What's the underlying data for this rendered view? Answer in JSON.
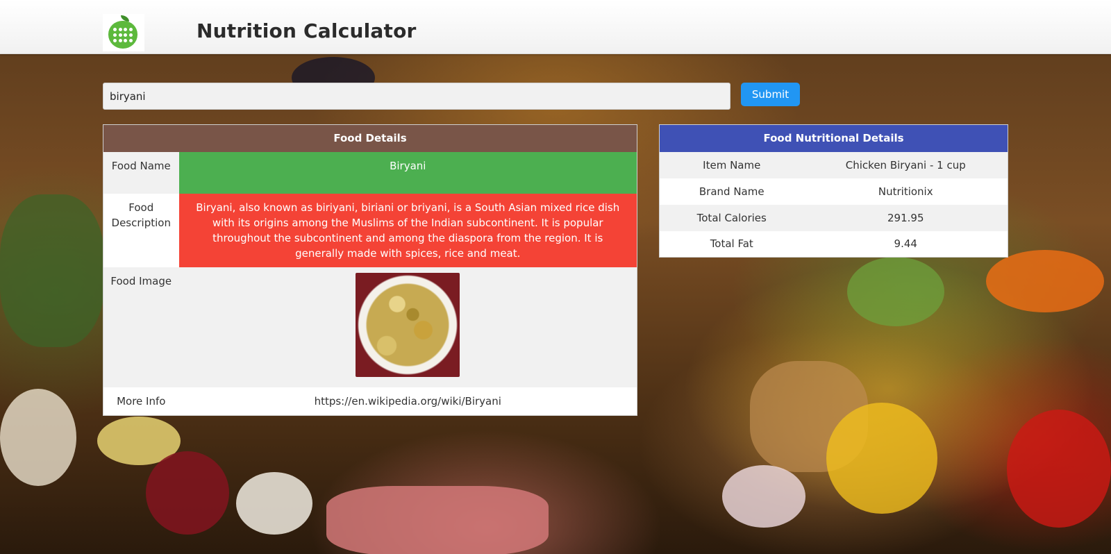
{
  "header": {
    "title": "Nutrition Calculator"
  },
  "search": {
    "value": "biryani",
    "submit_label": "Submit"
  },
  "food_details": {
    "heading": "Food Details",
    "rows": {
      "name": {
        "label": "Food Name",
        "value": "Biryani"
      },
      "description": {
        "label": "Food Description",
        "value": "Biryani, also known as biriyani, biriani or briyani, is a South Asian mixed rice dish with its origins among the Muslims of the Indian subcontinent. It is popular throughout the subcontinent and among the diaspora from the region. It is generally made with spices, rice and meat."
      },
      "image": {
        "label": "Food Image"
      },
      "more_info": {
        "label": "More Info",
        "value": "https://en.wikipedia.org/wiki/Biryani"
      }
    }
  },
  "nutrition": {
    "heading": "Food Nutritional Details",
    "rows": [
      {
        "label": "Item Name",
        "value": "Chicken Biryani - 1 cup"
      },
      {
        "label": "Brand Name",
        "value": "Nutritionix"
      },
      {
        "label": "Total Calories",
        "value": "291.95"
      },
      {
        "label": "Total Fat",
        "value": "9.44"
      }
    ]
  },
  "colors": {
    "details_header": "#795548",
    "nutrition_header": "#3f51b5",
    "name_cell": "#4caf50",
    "description_cell": "#f44336",
    "submit_button": "#2196f3"
  }
}
